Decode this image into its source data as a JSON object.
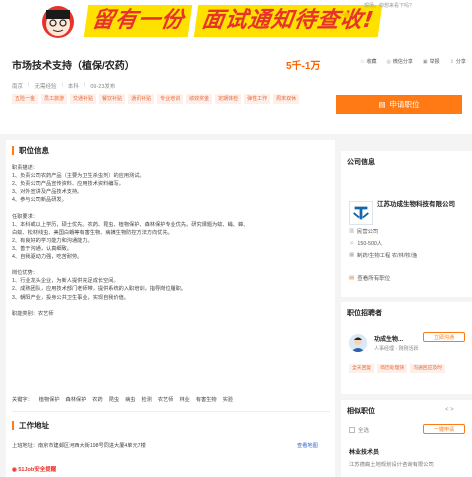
{
  "banner": {
    "text1": "留有一份",
    "text2": "面试通知待查收!",
    "hint": "现场，你想来看下吗?"
  },
  "job": {
    "title": "市场技术支持（植保/农药）",
    "salary": "5千-1万",
    "meta": [
      "南京",
      "无需经验",
      "本科",
      "09-23发布"
    ],
    "tags": [
      "五险一金",
      "员工旅游",
      "交通补贴",
      "餐饮补贴",
      "通讯补贴",
      "专业培训",
      "绩效奖金",
      "定期体检",
      "弹性工作",
      "周末双休"
    ]
  },
  "actions": {
    "collect": "收藏",
    "share": "微信分享",
    "report": "举报",
    "more": "分享"
  },
  "apply_label": "申请职位",
  "job_info": {
    "heading": "职位信息",
    "lines": [
      "职责描述：",
      "1、负责公司农药产品（主要为卫生杀虫剂）的应用测试。",
      "2、负责公司产品宣传资料、应用技术资料编写。",
      "3、对外宣讲及产品技术支持。",
      "4、参与公司新品研发。",
      "",
      "任职要求：",
      "1、本科或以上学历，硕士优先。农药、昆虫、植物保护、森林保护专业优先。研究课题为蚊、蝇、蟑、",
      "白蚁、松材线虫、美国白蛾等有害生物、病媒生物防控方法方向优先。",
      "2、有良好的学习能力和沟通能力。",
      "3、善于沟通，认真细致。",
      "4、自我驱动力强，吃苦耐劳。",
      "",
      "岗位优势：",
      "1、行业龙头企业，为新人提供充足成长空间。",
      "2、成熟团队，应用技术部门老师带，提供系统的入职培训，指导岗位履职。",
      "3、朝阳产业，投身公共卫生事业，实现自我价值。",
      "",
      "职能类别：农艺师"
    ],
    "keywords_label": "关键字：",
    "keywords": [
      "植物保护",
      "森林保护",
      "农药",
      "昆虫",
      "病虫",
      "检测",
      "农艺师",
      "林业",
      "有害生物",
      "实验"
    ]
  },
  "work_address": {
    "heading": "工作地址",
    "label": "上班地址：",
    "value": "南京市建邺区河西大街198号同进大厦4单元7楼",
    "map_link": "查看地图"
  },
  "safety": "51Job安全提醒",
  "company": {
    "heading": "公司信息",
    "name": "江苏功成生物科技有限公司",
    "type": "民营公司",
    "size": "150-500人",
    "industry": "制药/生物工程  农/林/牧/渔",
    "all_jobs": "查看所有职位"
  },
  "recruiter": {
    "heading": "职位招聘者",
    "name": "功成生物...",
    "role": "人事经理 · 刚刚活跃",
    "chat": "立即沟通",
    "tags": [
      "全天回复",
      "简历处理快",
      "沟通回应及时"
    ]
  },
  "related": {
    "heading": "相似职位",
    "nav": "< >",
    "select_all": "全选",
    "apply": "一键申请",
    "job_title": "林业技术员",
    "job_company": "江苏德裔土地规划设计咨询有限公司"
  },
  "colors": {
    "accent": "#ff7a14",
    "salary": "#ff6000",
    "tag_text": "#e8673a",
    "tag_bg": "#fdf0ea"
  }
}
